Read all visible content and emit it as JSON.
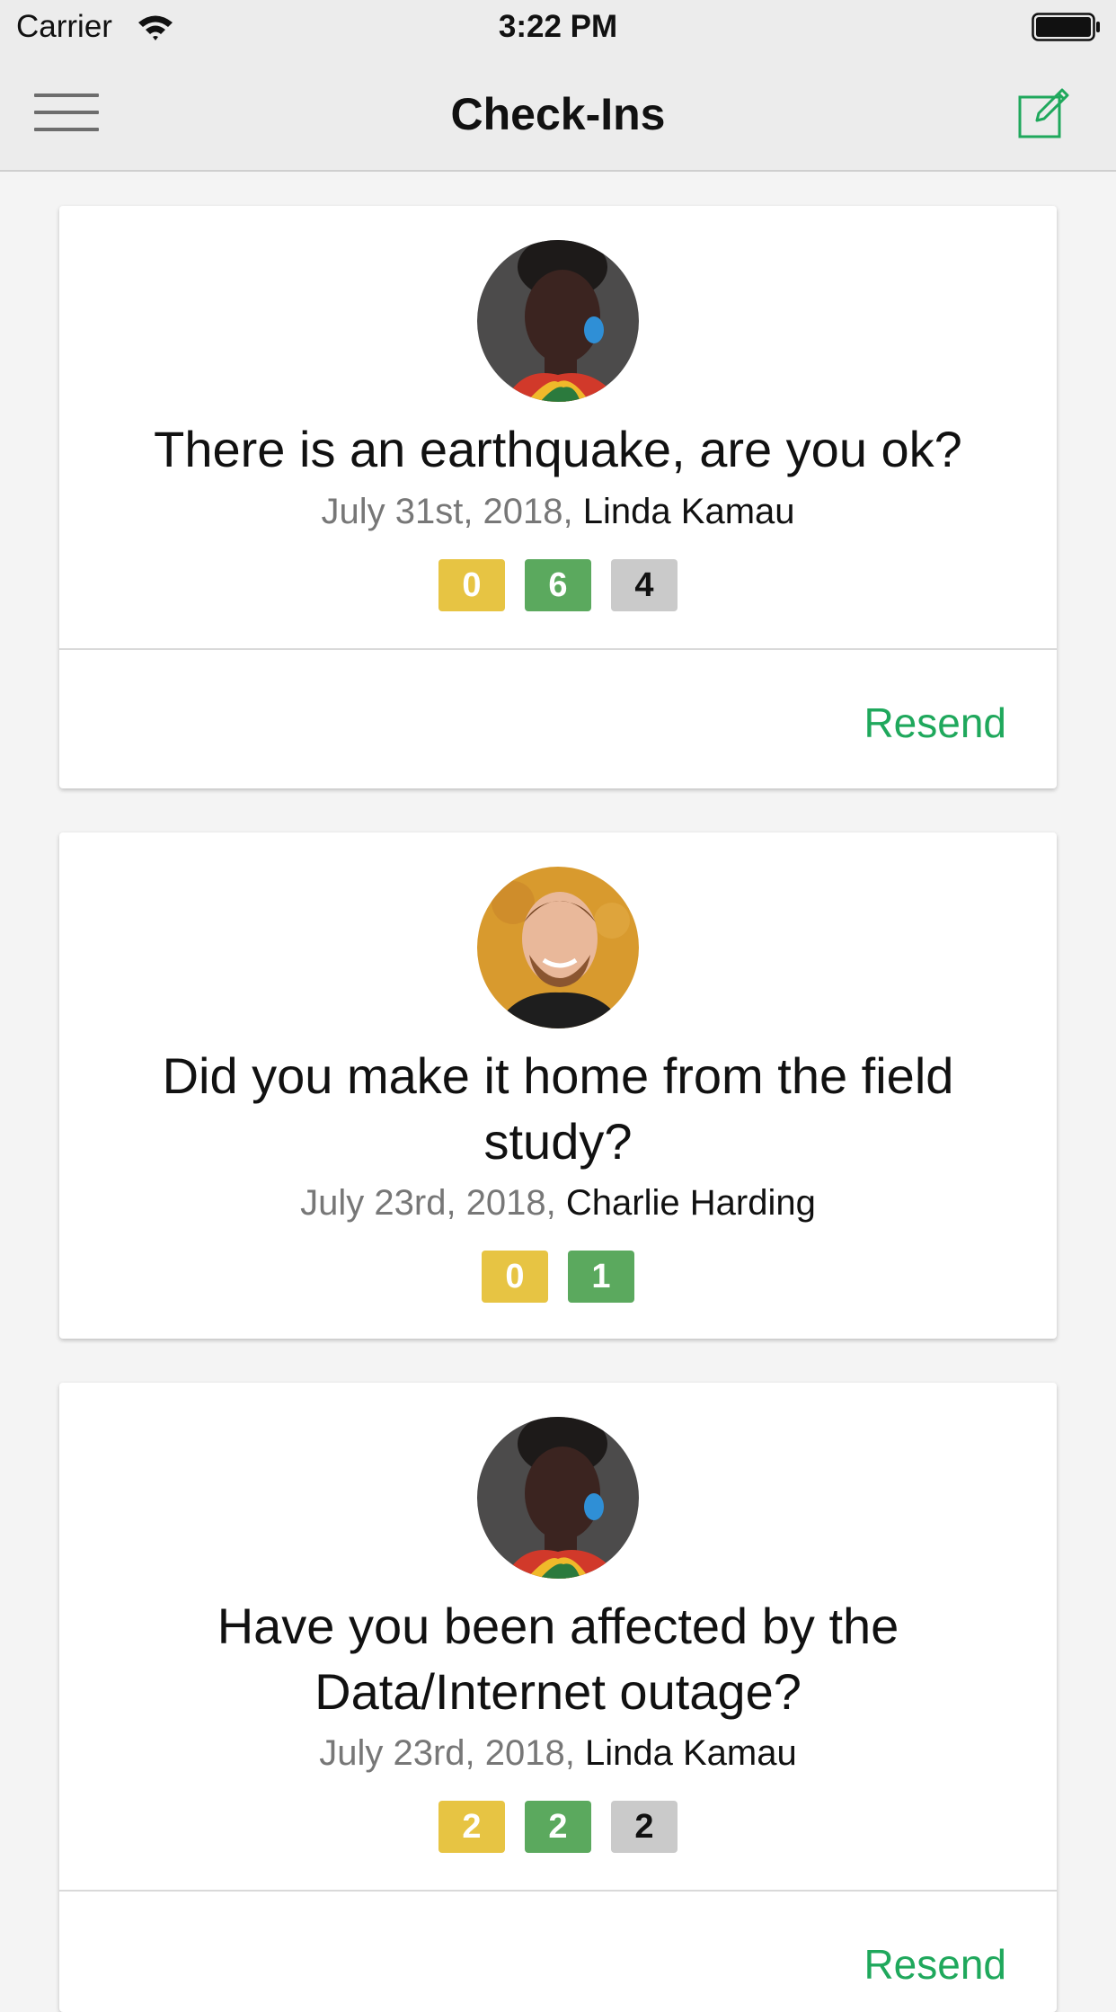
{
  "status_bar": {
    "carrier": "Carrier",
    "time": "3:22 PM",
    "wifi_icon": "wifi-icon",
    "battery_icon": "battery-icon"
  },
  "nav": {
    "title": "Check-Ins",
    "menu_icon": "hamburger-menu-icon",
    "compose_icon": "compose-icon"
  },
  "colors": {
    "accent": "#1fa85c",
    "badge_yellow": "#e7c443",
    "badge_green": "#5ba95e",
    "badge_gray": "#cacaca",
    "background": "#f4f4f4"
  },
  "cards": [
    {
      "question": "There is an earthquake, are you ok?",
      "date": "July 31st, 2018,",
      "author": "Linda Kamau",
      "badges": [
        "0",
        "6",
        "4"
      ],
      "action": "Resend"
    },
    {
      "question": "Did you make it home from the field study?",
      "date": "July 23rd, 2018,",
      "author": "Charlie Harding",
      "badges": [
        "0",
        "1"
      ]
    },
    {
      "question": "Have you been affected by the Data/Internet outage?",
      "date": "July 23rd, 2018,",
      "author": "Linda Kamau",
      "badges": [
        "2",
        "2",
        "2"
      ],
      "action": "Resend"
    }
  ]
}
